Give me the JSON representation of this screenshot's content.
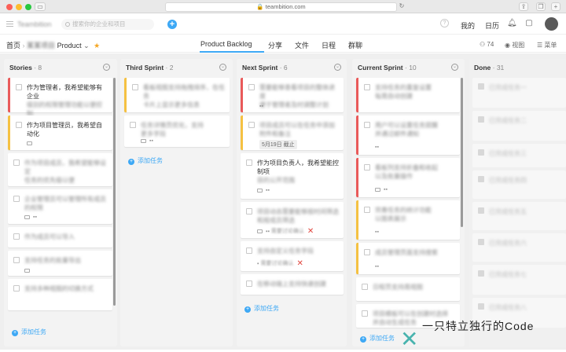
{
  "browser": {
    "url": "teambition.com"
  },
  "header": {
    "logo_text": "Teambition",
    "search_placeholder": "搜索你的企业和项目",
    "my_label": "我的",
    "calendar_label": "日历"
  },
  "project_nav": {
    "home": "首页",
    "project_blur": "某某项目",
    "project_name": "Product",
    "tabs": [
      "Product Backlog",
      "分享",
      "文件",
      "日程",
      "群聊"
    ],
    "member_count": "74",
    "view_label": "视图",
    "menu_label": "菜单"
  },
  "columns": [
    {
      "title": "Stories",
      "count": "· 8",
      "cards": [
        {
          "line1": "作为管理者，我希望能够有企业",
          "line2": "级别的权限管理功能以便控制"
        },
        {
          "line1": "作为项目管理员，我希望自动化",
          "line2": ""
        },
        {
          "line1": "作为项目成员，我希望能够设定",
          "line2": "任务的优先级以便"
        },
        {
          "line1": "企业管理员可以管理所有成员",
          "line2": "的权限"
        },
        {
          "line1": "作为成员可以导入",
          "line2": ""
        },
        {
          "line1": "支持任务的批量导出",
          "line2": ""
        },
        {
          "line1": "支持多种视图的切换方式",
          "line2": ""
        }
      ],
      "add_label": "添加任务"
    },
    {
      "title": "Third Sprint",
      "count": "· 2",
      "cards": [
        {
          "line1": "看板视图支持拖拽排序，在任务",
          "line2": "卡片上显示更多信息"
        },
        {
          "line1": "任务详情页优化，支持",
          "line2": "更多字段"
        }
      ],
      "add_label": "添加任务"
    },
    {
      "title": "Next Sprint",
      "count": "· 6",
      "cards": [
        {
          "line1": "需要能够查看项目的整体进度",
          "line2": "便于管理者及时调整计划"
        },
        {
          "line1": "项目成员可以在任务中添加",
          "line2": "附件和备注",
          "date": "5月19日 截止"
        },
        {
          "line1": "作为项目负责人，我希望能控制项",
          "line2": "目的公开范围"
        },
        {
          "line1": "项目动态需要能够按时间筛选",
          "line2": "和按成员筛选",
          "meta2": "需要讨论确认"
        },
        {
          "line1": "支持自定义任务字段",
          "line2": "",
          "meta2": "需要讨论确认"
        },
        {
          "line1": "在移动端上支持快速创建",
          "line2": ""
        }
      ],
      "add_label": "添加任务"
    },
    {
      "title": "Current Sprint",
      "count": "· 10",
      "cards": [
        {
          "line1": "支持任务的重复设置",
          "line2": "每周自动创建"
        },
        {
          "line1": "用户可以设置任务提醒",
          "line2": "并通过邮件通知"
        },
        {
          "line1": "看板列支持折叠和收起",
          "line2": "以及批量操作"
        },
        {
          "line1": "完善任务的统计功能",
          "line2": "以图表展示"
        },
        {
          "line1": "成员管理页面支持搜索",
          "line2": ""
        },
        {
          "line1": "日程页支持周视图",
          "line2": ""
        },
        {
          "line1": "项目模板可以在创建时选择",
          "line2": "并自动生成任务"
        }
      ],
      "add_label": "添加任务"
    },
    {
      "title": "Done",
      "count": "· 31",
      "cards": [
        {
          "line1": "已完成任务一"
        },
        {
          "line1": "已完成任务二"
        },
        {
          "line1": "已完成任务三"
        },
        {
          "line1": "已完成任务四"
        },
        {
          "line1": "已完成任务五"
        },
        {
          "line1": "已完成任务六"
        },
        {
          "line1": "已完成任务七"
        },
        {
          "line1": "已完成任务八"
        }
      ]
    }
  ],
  "watermark": {
    "text": "一只特立独行的Code"
  },
  "colors": {
    "accent": "#3da8f5",
    "priority_red": "#e95a5a",
    "priority_yellow": "#f5c142"
  }
}
